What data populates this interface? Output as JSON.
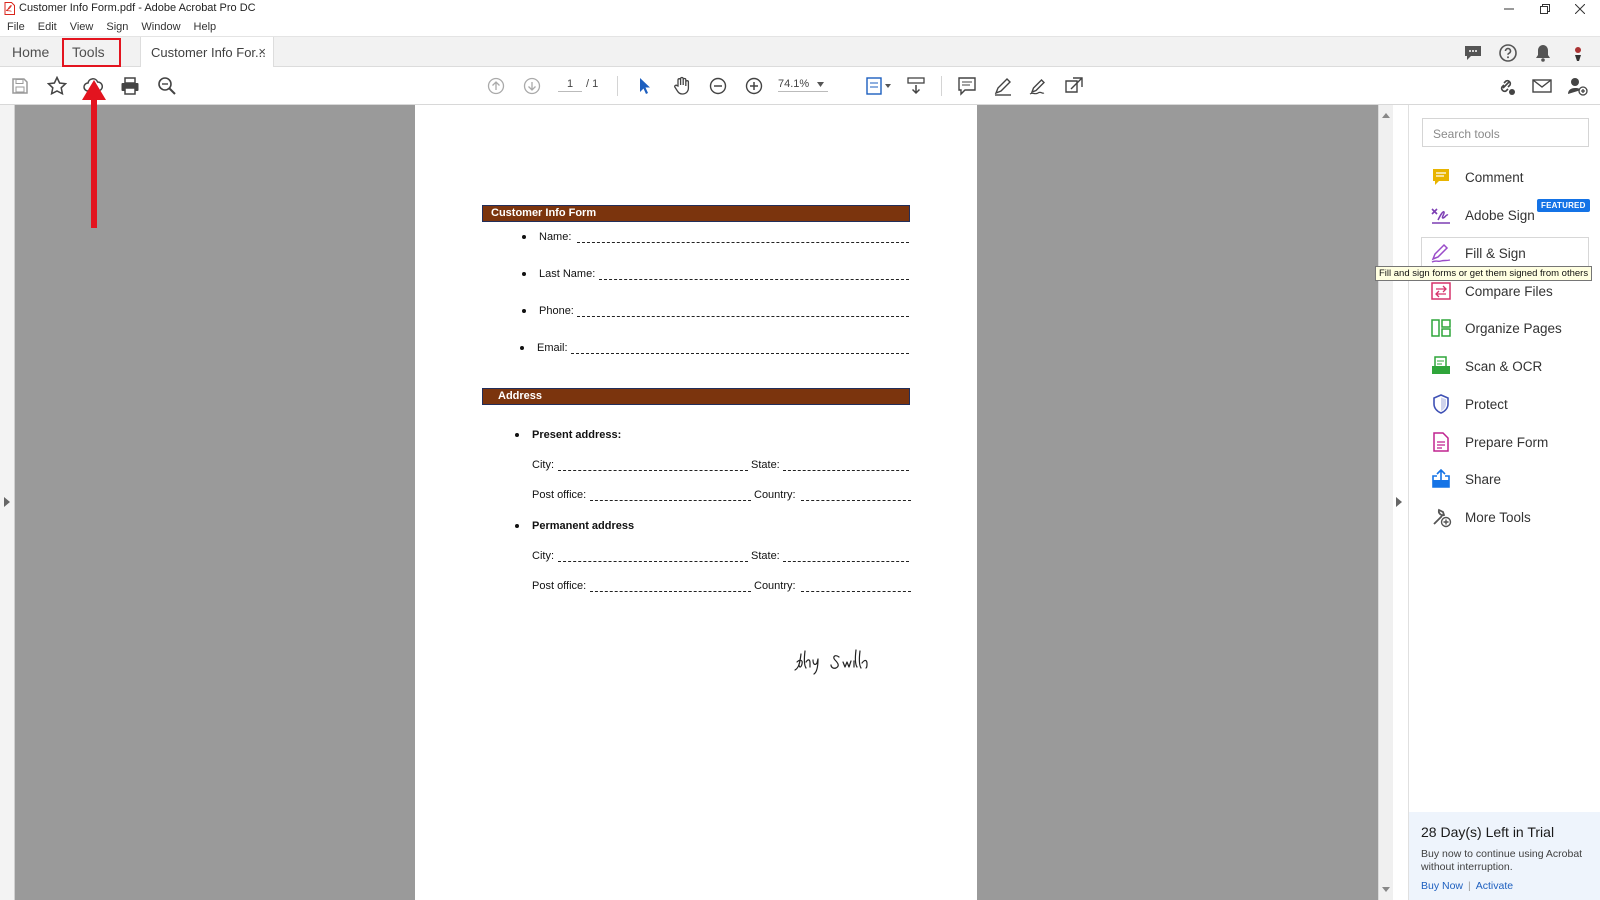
{
  "window": {
    "title": "Customer Info Form.pdf - Adobe Acrobat Pro DC"
  },
  "menu": [
    "File",
    "Edit",
    "View",
    "Sign",
    "Window",
    "Help"
  ],
  "tabs": {
    "home": "Home",
    "tools": "Tools",
    "document": "Customer Info For...",
    "close": "×"
  },
  "toolbar": {
    "page_current": "1",
    "page_total": "/ 1",
    "zoom": "74.1%"
  },
  "form": {
    "header1": "Customer Info Form",
    "fields1": [
      "Name:",
      "Last Name:",
      "Phone:",
      "Email:"
    ],
    "header2": "Address",
    "present": "Present address:",
    "permanent": "Permanent address",
    "city": "City:",
    "state": "State:",
    "post_office": "Post office:",
    "country": "Country:"
  },
  "panel": {
    "search_placeholder": "Search tools",
    "featured_badge": "FEATURED",
    "tools": [
      {
        "label": "Comment",
        "icon": "comment-icon",
        "color": "#e8b400"
      },
      {
        "label": "Adobe Sign",
        "icon": "adobe-sign-icon",
        "color": "#7d3fb4"
      },
      {
        "label": "Fill & Sign",
        "icon": "fill-sign-icon",
        "color": "#9a4cc9"
      },
      {
        "label": "Compare Files",
        "icon": "compare-files-icon",
        "color": "#d6336c"
      },
      {
        "label": "Organize Pages",
        "icon": "organize-pages-icon",
        "color": "#2fa53a"
      },
      {
        "label": "Scan & OCR",
        "icon": "scan-ocr-icon",
        "color": "#2fa53a"
      },
      {
        "label": "Protect",
        "icon": "protect-icon",
        "color": "#3f51b5"
      },
      {
        "label": "Prepare Form",
        "icon": "prepare-form-icon",
        "color": "#c0238f"
      },
      {
        "label": "Share",
        "icon": "share-icon",
        "color": "#1473e6"
      },
      {
        "label": "More Tools",
        "icon": "more-tools-icon",
        "color": "#555555"
      }
    ],
    "tooltip": "Fill and sign forms or get them signed from others",
    "trial": {
      "title": "28 Day(s) Left in Trial",
      "message": "Buy now to continue using Acrobat without interruption.",
      "buy": "Buy Now",
      "activate": "Activate"
    }
  },
  "colors": {
    "form_header": "#7b340d",
    "highlight": "#e3141f",
    "link": "#1d5fbf"
  }
}
